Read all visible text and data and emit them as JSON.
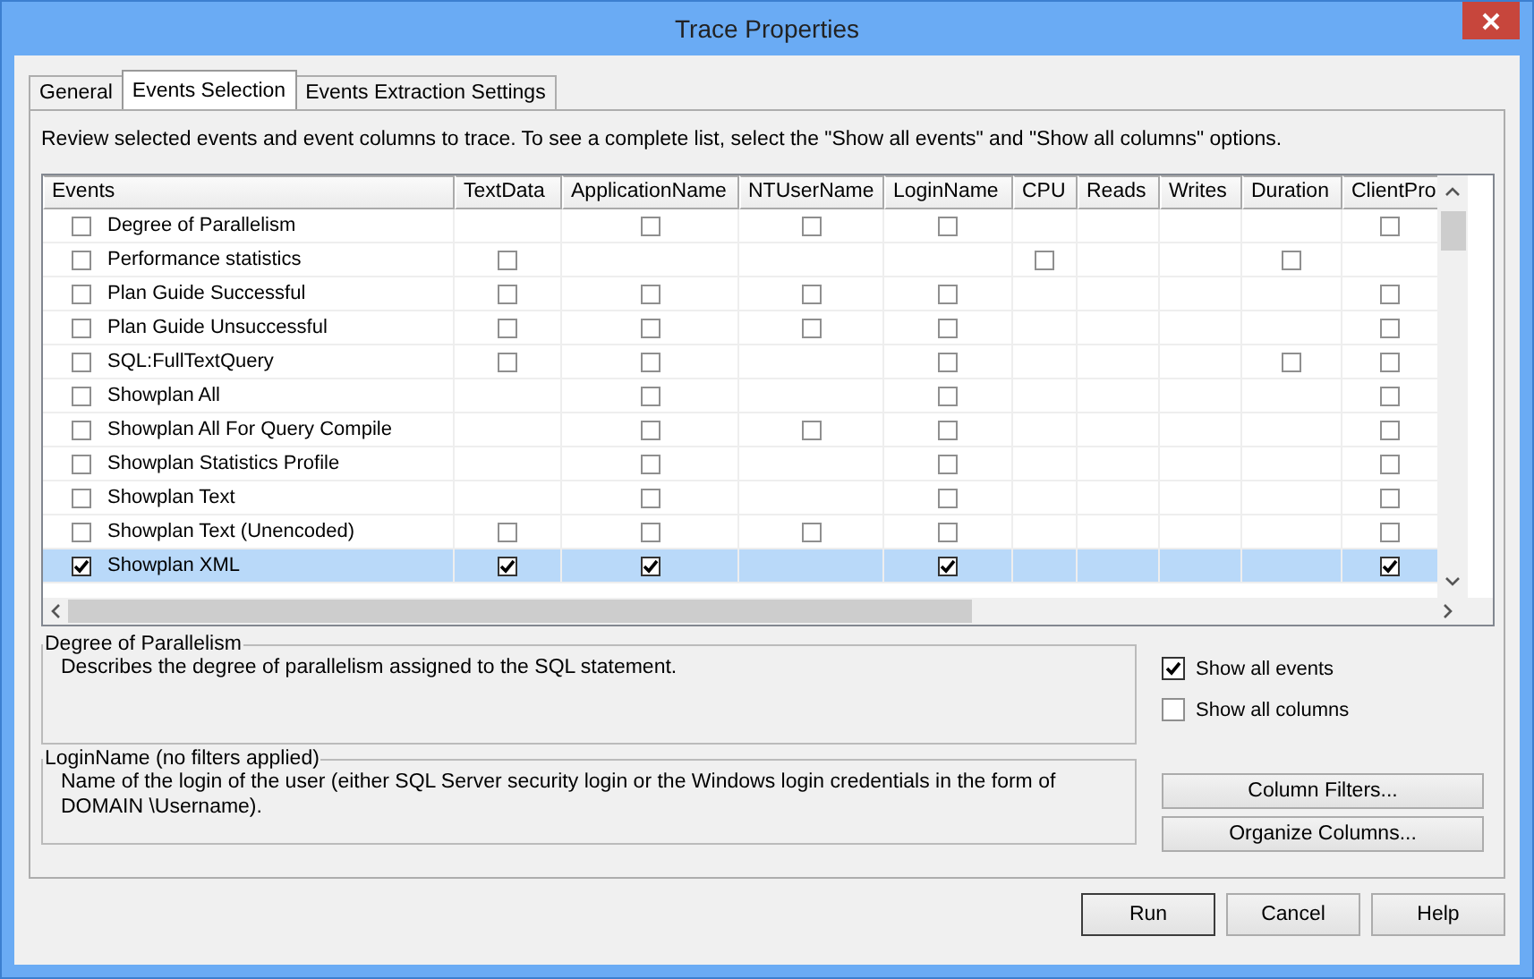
{
  "window": {
    "title": "Trace Properties"
  },
  "tabs": [
    {
      "label": "General",
      "selected": false
    },
    {
      "label": "Events Selection",
      "selected": true
    },
    {
      "label": "Events Extraction Settings",
      "selected": false
    }
  ],
  "intro": "Review selected events and event columns to trace. To see a complete list, select the \"Show all events\" and \"Show all columns\" options.",
  "grid": {
    "columns": [
      "Events",
      "TextData",
      "ApplicationName",
      "NTUserName",
      "LoginName",
      "CPU",
      "Reads",
      "Writes",
      "Duration",
      "ClientPro"
    ],
    "rows": [
      {
        "name": "Degree of Parallelism",
        "checked": false,
        "selected": false,
        "cells": [
          null,
          false,
          false,
          false,
          null,
          null,
          null,
          null,
          false
        ]
      },
      {
        "name": "Performance statistics",
        "checked": false,
        "selected": false,
        "cells": [
          false,
          null,
          null,
          null,
          false,
          null,
          null,
          false,
          null
        ]
      },
      {
        "name": "Plan Guide Successful",
        "checked": false,
        "selected": false,
        "cells": [
          false,
          false,
          false,
          false,
          null,
          null,
          null,
          null,
          false
        ]
      },
      {
        "name": "Plan Guide Unsuccessful",
        "checked": false,
        "selected": false,
        "cells": [
          false,
          false,
          false,
          false,
          null,
          null,
          null,
          null,
          false
        ]
      },
      {
        "name": "SQL:FullTextQuery",
        "checked": false,
        "selected": false,
        "cells": [
          false,
          false,
          null,
          false,
          null,
          null,
          null,
          false,
          false
        ]
      },
      {
        "name": "Showplan All",
        "checked": false,
        "selected": false,
        "cells": [
          null,
          false,
          null,
          false,
          null,
          null,
          null,
          null,
          false
        ]
      },
      {
        "name": "Showplan All For Query Compile",
        "checked": false,
        "selected": false,
        "cells": [
          null,
          false,
          false,
          false,
          null,
          null,
          null,
          null,
          false
        ]
      },
      {
        "name": "Showplan Statistics Profile",
        "checked": false,
        "selected": false,
        "cells": [
          null,
          false,
          null,
          false,
          null,
          null,
          null,
          null,
          false
        ]
      },
      {
        "name": "Showplan Text",
        "checked": false,
        "selected": false,
        "cells": [
          null,
          false,
          null,
          false,
          null,
          null,
          null,
          null,
          false
        ]
      },
      {
        "name": "Showplan Text (Unencoded)",
        "checked": false,
        "selected": false,
        "cells": [
          false,
          false,
          false,
          false,
          null,
          null,
          null,
          null,
          false
        ]
      },
      {
        "name": "Showplan XML",
        "checked": true,
        "selected": true,
        "cells": [
          true,
          true,
          null,
          true,
          null,
          null,
          null,
          null,
          true
        ]
      }
    ]
  },
  "event_description": {
    "title": "Degree of Parallelism",
    "text": "Describes the degree of parallelism assigned to the SQL statement."
  },
  "column_description": {
    "title": "LoginName (no filters applied)",
    "text": "Name of the login of the user (either SQL Server security login or the Windows login credentials in the form of DOMAIN \\Username)."
  },
  "options": [
    {
      "label": "Show all events",
      "checked": true
    },
    {
      "label": "Show all columns",
      "checked": false
    }
  ],
  "side_buttons": [
    "Column Filters...",
    "Organize Columns..."
  ],
  "buttons": [
    "Run",
    "Cancel",
    "Help"
  ]
}
